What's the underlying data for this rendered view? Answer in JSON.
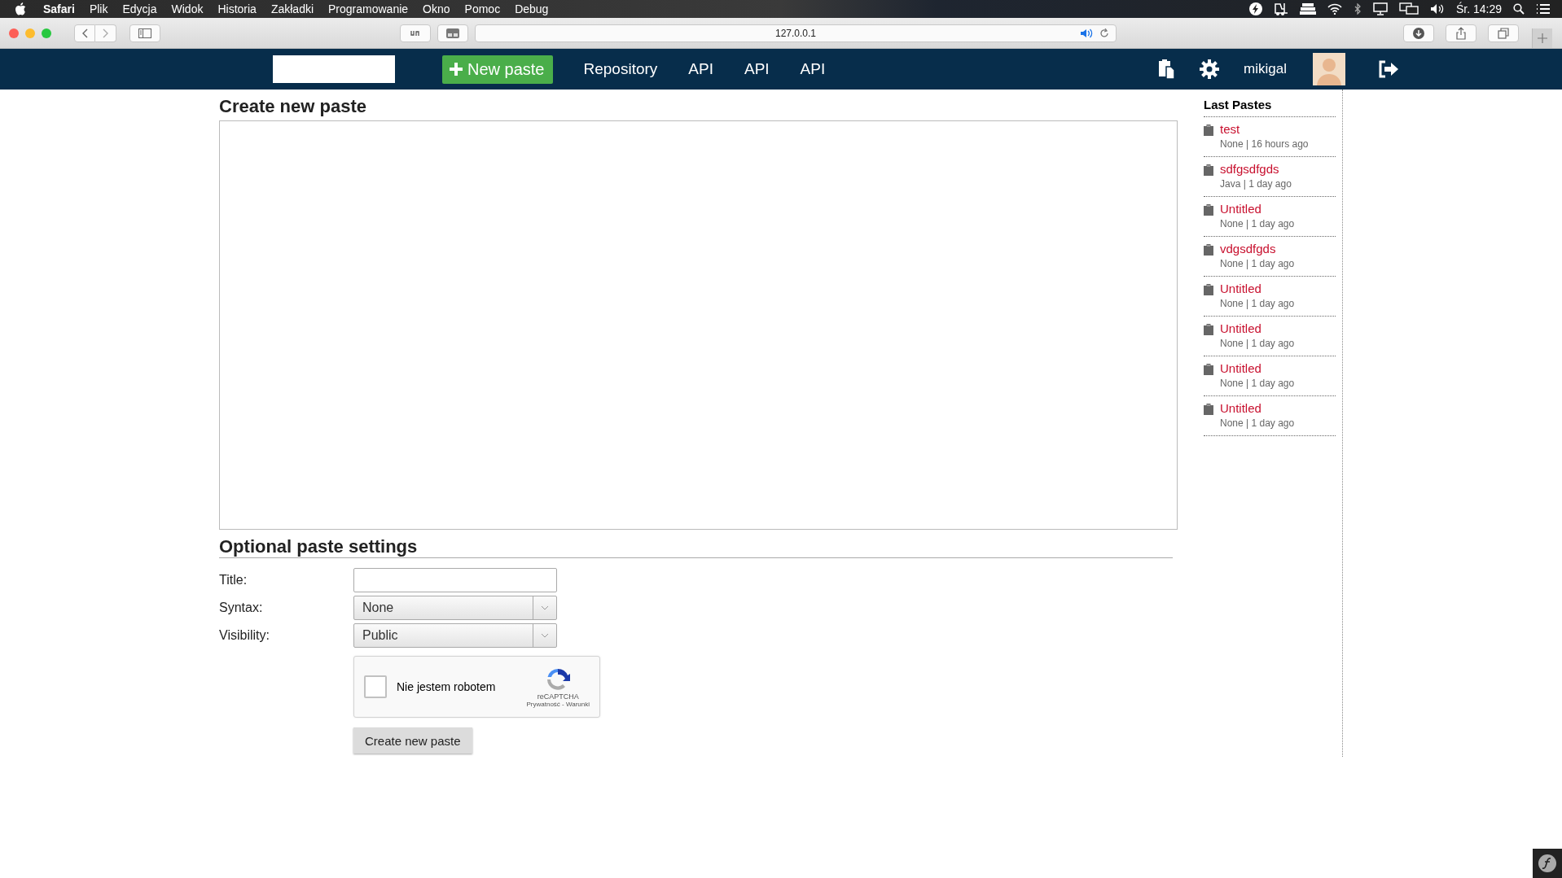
{
  "menubar": {
    "app": "Safari",
    "menus": [
      "Plik",
      "Edycja",
      "Widok",
      "Historia",
      "Zakładki",
      "Programowanie",
      "Okno",
      "Pomoc",
      "Debug"
    ],
    "clock": "Śr. 14:29"
  },
  "browser": {
    "url": "127.0.0.1"
  },
  "navbar": {
    "new_paste": "New paste",
    "links": [
      "Repository",
      "API",
      "API",
      "API"
    ],
    "username": "mikigal"
  },
  "main": {
    "heading": "Create new paste",
    "settings_heading": "Optional paste settings",
    "fields": [
      {
        "label": "Title:",
        "kind": "input"
      },
      {
        "label": "Syntax:",
        "kind": "select",
        "value": "None"
      },
      {
        "label": "Visibility:",
        "kind": "select",
        "value": "Public"
      }
    ],
    "captcha": {
      "checked": false,
      "label": "Nie jestem robotem",
      "brand": "reCAPTCHA",
      "links": "Prywatność - Warunki"
    },
    "submit": "Create new paste"
  },
  "sidebar": {
    "title": "Last Pastes",
    "pastes": [
      {
        "title": "test",
        "meta": "None | 16 hours ago"
      },
      {
        "title": "sdfgsdfgds",
        "meta": "Java | 1 day ago"
      },
      {
        "title": "Untitled",
        "meta": "None | 1 day ago"
      },
      {
        "title": "vdgsdfgds",
        "meta": "None | 1 day ago"
      },
      {
        "title": "Untitled",
        "meta": "None | 1 day ago"
      },
      {
        "title": "Untitled",
        "meta": "None | 1 day ago"
      },
      {
        "title": "Untitled",
        "meta": "None | 1 day ago"
      },
      {
        "title": "Untitled",
        "meta": "None | 1 day ago"
      }
    ]
  }
}
